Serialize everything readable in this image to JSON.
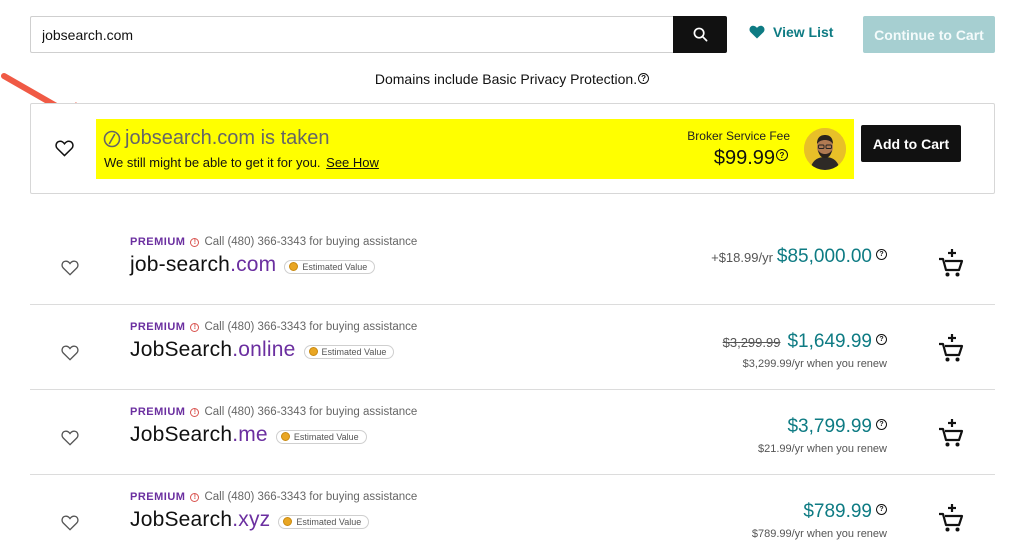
{
  "search": {
    "value": "jobsearch.com"
  },
  "header": {
    "view_list_label": "View List",
    "continue_label": "Continue to Cart",
    "privacy_note": "Domains include Basic Privacy Protection."
  },
  "taken": {
    "title": "jobsearch.com is taken",
    "subtitle": "We still might be able to get it for you.",
    "see_how": "See How",
    "broker_label": "Broker Service Fee",
    "broker_price": "$99.99",
    "add_to_cart": "Add to Cart"
  },
  "results": [
    {
      "premium": "PREMIUM",
      "call_text": "Call (480) 366-3343 for buying assistance",
      "sld": "job-search",
      "tld": ".com",
      "badge": "Estimated Value",
      "price_prefix": "+$18.99/yr",
      "strike_price": "",
      "price": "$85,000.00",
      "renew_note": ""
    },
    {
      "premium": "PREMIUM",
      "call_text": "Call (480) 366-3343 for buying assistance",
      "sld": "JobSearch",
      "tld": ".online",
      "badge": "Estimated Value",
      "price_prefix": "",
      "strike_price": "$3,299.99",
      "price": "$1,649.99",
      "renew_note": "$3,299.99/yr when you renew"
    },
    {
      "premium": "PREMIUM",
      "call_text": "Call (480) 366-3343 for buying assistance",
      "sld": "JobSearch",
      "tld": ".me",
      "badge": "Estimated Value",
      "price_prefix": "",
      "strike_price": "",
      "price": "$3,799.99",
      "renew_note": "$21.99/yr when you renew"
    },
    {
      "premium": "PREMIUM",
      "call_text": "Call (480) 366-3343 for buying assistance",
      "sld": "JobSearch",
      "tld": ".xyz",
      "badge": "Estimated Value",
      "price_prefix": "",
      "strike_price": "",
      "price": "$789.99",
      "renew_note": "$789.99/yr when you renew"
    }
  ],
  "colors": {
    "accent_teal": "#0e7b83",
    "premium_purple": "#6b2fa0",
    "highlight_yellow": "#ffff00",
    "annotation_arrow": "#f05a45"
  }
}
